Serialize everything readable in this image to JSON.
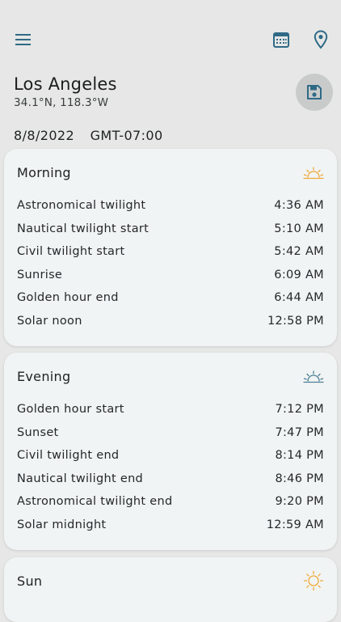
{
  "header": {
    "menu_icon": "hamburger-menu-icon",
    "calendar_icon": "calendar-icon",
    "location_icon": "location-pin-icon"
  },
  "location": {
    "city": "Los Angeles",
    "coords": "34.1°N, 118.3°W",
    "save_icon": "floppy-disk-icon"
  },
  "date": {
    "date": "8/8/2022",
    "timezone": "GMT-07:00"
  },
  "colors": {
    "accent": "#2f6a86",
    "sunrise": "#f0a93a",
    "sunset": "#4d7f95",
    "sun": "#f0a93a"
  },
  "morning": {
    "title": "Morning",
    "icon": "sunrise-icon",
    "rows": [
      {
        "label": "Astronomical twilight",
        "time": "4:36 AM"
      },
      {
        "label": "Nautical twilight start",
        "time": "5:10 AM"
      },
      {
        "label": "Civil twilight start",
        "time": "5:42 AM"
      },
      {
        "label": "Sunrise",
        "time": "6:09 AM"
      },
      {
        "label": "Golden hour end",
        "time": "6:44 AM"
      },
      {
        "label": "Solar noon",
        "time": "12:58 PM"
      }
    ]
  },
  "evening": {
    "title": "Evening",
    "icon": "sunset-icon",
    "rows": [
      {
        "label": "Golden hour start",
        "time": "7:12 PM"
      },
      {
        "label": "Sunset",
        "time": "7:47 PM"
      },
      {
        "label": "Civil twilight end",
        "time": "8:14 PM"
      },
      {
        "label": "Nautical twilight end",
        "time": "8:46 PM"
      },
      {
        "label": "Astronomical twilight end",
        "time": "9:20 PM"
      },
      {
        "label": "Solar midnight",
        "time": "12:59 AM"
      }
    ]
  },
  "sun": {
    "title": "Sun",
    "icon": "sun-icon"
  }
}
